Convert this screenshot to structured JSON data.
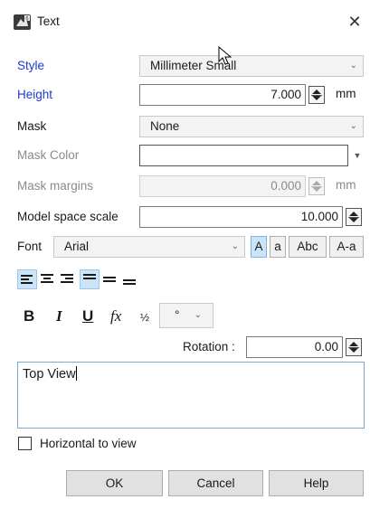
{
  "window": {
    "title": "Text",
    "close_glyph": "✕",
    "icon": "rhino-text-icon"
  },
  "style": {
    "label": "Style",
    "value": "Millimeter Small"
  },
  "height": {
    "label": "Height",
    "value": "7.000",
    "unit": "mm"
  },
  "mask": {
    "label": "Mask",
    "value": "None"
  },
  "mask_color": {
    "label": "Mask Color",
    "value": ""
  },
  "mask_margins": {
    "label": "Mask margins",
    "value": "0.000",
    "unit": "mm"
  },
  "model_space_scale": {
    "label": "Model space scale",
    "value": "10.000"
  },
  "font": {
    "label": "Font",
    "value": "Arial",
    "case_buttons": [
      "A",
      "a",
      "Abc",
      "A-a"
    ],
    "active_case": "A"
  },
  "alignment": {
    "icons": [
      "align-left-icon",
      "align-center-icon",
      "align-right-icon",
      "align-top-icon",
      "align-middle-icon",
      "align-bottom-icon"
    ],
    "active": [
      "align-left-icon",
      "align-top-icon"
    ]
  },
  "format": {
    "bold": "B",
    "italic": "I",
    "underline": "U",
    "function": "fx",
    "fraction": "½",
    "symbol_value": "°"
  },
  "rotation": {
    "label": "Rotation :",
    "value": "0.00"
  },
  "text_body": "Top View",
  "horizontal_to_view": {
    "label": "Horizontal to view",
    "checked": false
  },
  "buttons": {
    "ok": "OK",
    "cancel": "Cancel",
    "help": "Help"
  },
  "colors": {
    "accent_blue_label": "#1a3ccb",
    "active_button": "#cce4f7",
    "disabled_text": "#8a8a8a"
  }
}
